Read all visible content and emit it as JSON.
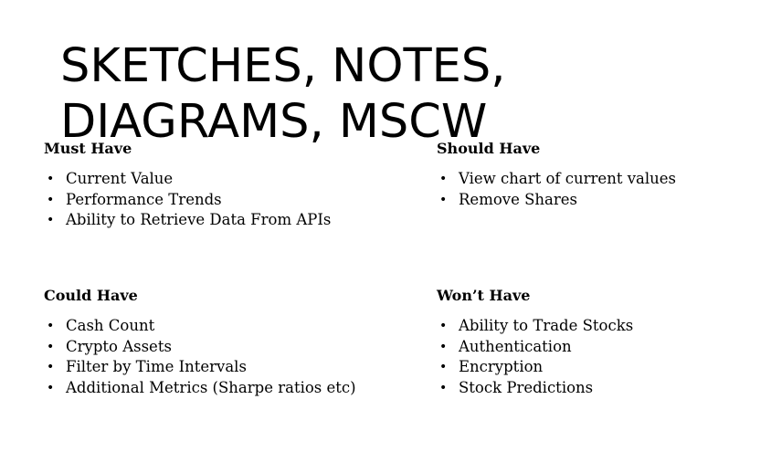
{
  "title": {
    "line1": "SKETCHES, NOTES,",
    "line2": "DIAGRAMS, MSCW"
  },
  "must_have": {
    "heading": "Must Have",
    "items": [
      "Current Value",
      "Performance Trends",
      "Ability to Retrieve Data From APIs"
    ]
  },
  "should_have": {
    "heading": "Should Have",
    "items": [
      "View chart of current values",
      "Remove Shares"
    ]
  },
  "could_have": {
    "heading": "Could Have",
    "items": [
      "Cash Count",
      "Crypto Assets",
      "Filter by Time Intervals",
      "Additional Metrics (Sharpe ratios etc)"
    ]
  },
  "wont_have": {
    "heading": "Won’t Have",
    "items": [
      "Ability to Trade Stocks",
      "Authentication",
      "Encryption",
      "Stock Predictions"
    ]
  },
  "bullet_glyph": "•"
}
